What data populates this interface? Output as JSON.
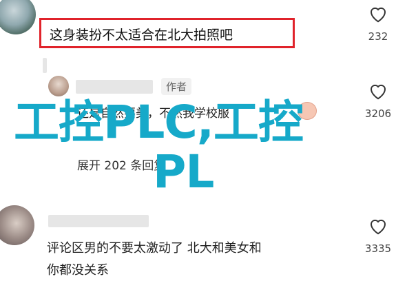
{
  "comments": [
    {
      "text": "这身装扮不太适合在北大拍照吧",
      "likes": "232"
    },
    {
      "author_tag": "作者",
      "text": "还是自然要美，不然我学校服",
      "expand": "展开 202 条回复",
      "likes": "3206"
    },
    {
      "text_line1": "评论区男的不要太激动了 北大和美女和",
      "text_line2": "你都没关系",
      "likes": "3335"
    }
  ],
  "watermark": {
    "line1": "工控PLC,工控",
    "line2": "PL"
  },
  "icons": {
    "like": "heart-outline-icon",
    "emoji": "face-emoji-icon"
  },
  "colors": {
    "highlight": "#e0232b",
    "watermark": "#16a9c9"
  }
}
